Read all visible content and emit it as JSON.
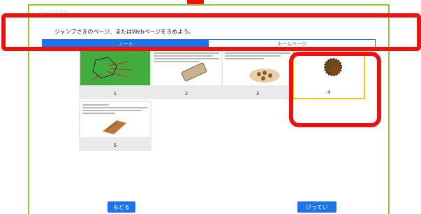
{
  "panel": {
    "faint_title": "ジャンプさき"
  },
  "instruction": "ジャンプさきのページ、またはWebページをきめよう。",
  "tabs": [
    {
      "label": "ノート",
      "active": true
    },
    {
      "label": "ホームページ",
      "active": false
    }
  ],
  "cards": [
    {
      "number": "1"
    },
    {
      "number": "2"
    },
    {
      "number": "3"
    },
    {
      "number": "4",
      "selected": true
    },
    {
      "number": "5"
    }
  ],
  "buttons": {
    "back": "もどる",
    "decide": "けってい"
  },
  "colors": {
    "accent": "#1e73e8",
    "panel_border": "#8cc63f",
    "selected_border": "#f5c518",
    "annotation": "#ee1111"
  }
}
